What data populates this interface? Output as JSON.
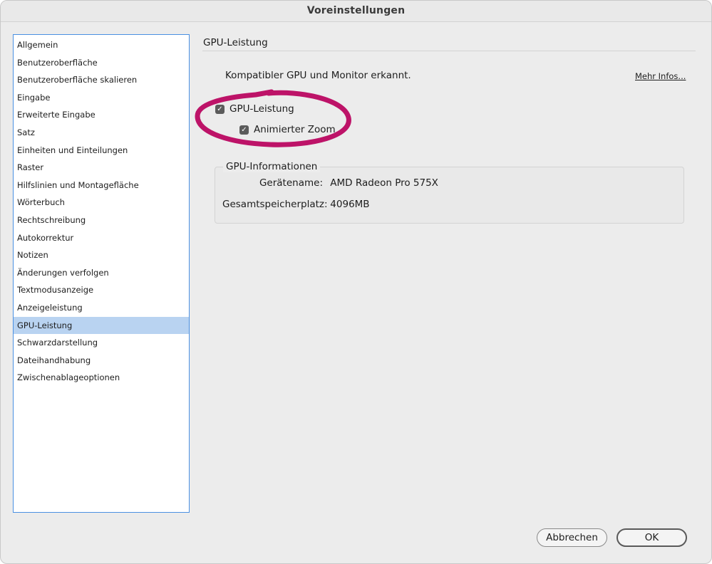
{
  "window": {
    "title": "Voreinstellungen"
  },
  "sidebar": {
    "items": [
      {
        "label": "Allgemein"
      },
      {
        "label": "Benutzeroberfläche"
      },
      {
        "label": "Benutzeroberfläche skalieren"
      },
      {
        "label": "Eingabe"
      },
      {
        "label": "Erweiterte Eingabe"
      },
      {
        "label": "Satz"
      },
      {
        "label": "Einheiten und Einteilungen"
      },
      {
        "label": "Raster"
      },
      {
        "label": "Hilfslinien und Montagefläche"
      },
      {
        "label": "Wörterbuch"
      },
      {
        "label": "Rechtschreibung"
      },
      {
        "label": "Autokorrektur"
      },
      {
        "label": "Notizen"
      },
      {
        "label": "Änderungen verfolgen"
      },
      {
        "label": "Textmodusanzeige"
      },
      {
        "label": "Anzeigeleistung"
      },
      {
        "label": "GPU-Leistung"
      },
      {
        "label": "Schwarzdarstellung"
      },
      {
        "label": "Dateihandhabung"
      },
      {
        "label": "Zwischenablageoptionen"
      }
    ],
    "selected_label": "GPU-Leistung"
  },
  "panel": {
    "title": "GPU-Leistung",
    "status_text": "Kompatibler GPU und Monitor erkannt.",
    "more_link": "Mehr Infos...",
    "gpu_performance": {
      "label": "GPU-Leistung",
      "checked": true
    },
    "animated_zoom": {
      "label": "Animierter Zoom",
      "checked": true
    },
    "gpu_info": {
      "title": "GPU-Informationen",
      "device_label": "Gerätename:",
      "device_value": "AMD Radeon Pro 575X",
      "memory_label": "Gesamtspeicherplatz:",
      "memory_value": "4096MB"
    }
  },
  "buttons": {
    "cancel": "Abbrechen",
    "ok": "OK"
  },
  "colors": {
    "selection": "#b9d3f1",
    "sidebar_border": "#4a90e2",
    "highlight_marker": "#b8005c"
  }
}
